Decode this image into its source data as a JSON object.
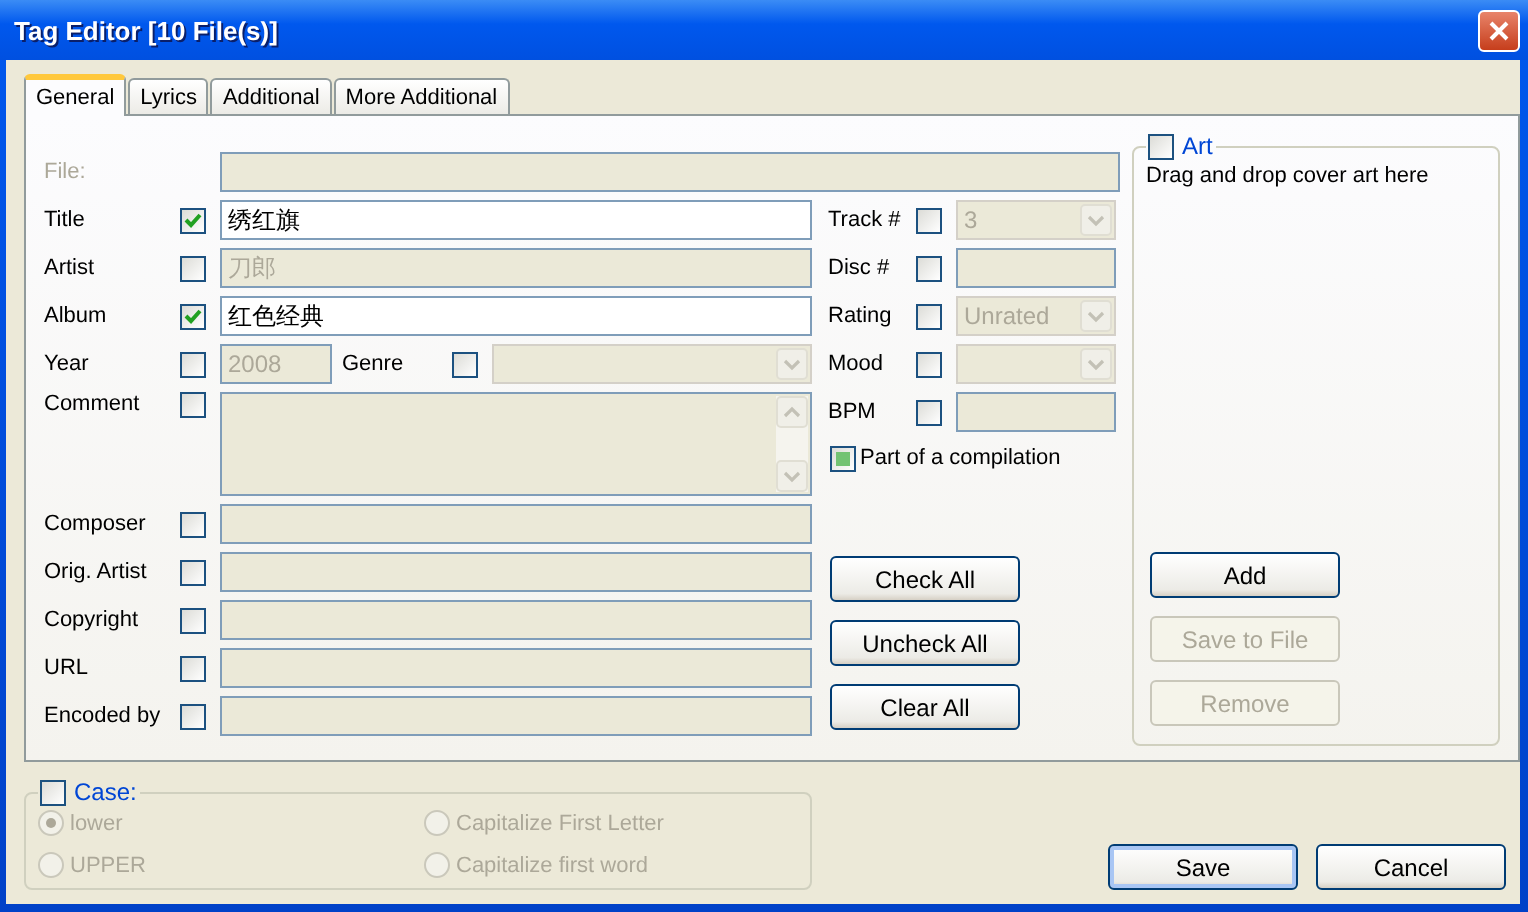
{
  "window": {
    "title": "Tag Editor [10 File(s)]"
  },
  "tabs": [
    {
      "label": "General",
      "selected": true
    },
    {
      "label": "Lyrics",
      "selected": false
    },
    {
      "label": "Additional",
      "selected": false
    },
    {
      "label": "More Additional",
      "selected": false
    }
  ],
  "file": {
    "label": "File:",
    "enabled": false
  },
  "fields": [
    {
      "kind": "text",
      "label": "Title",
      "checked": true,
      "value": "绣红旗"
    },
    {
      "kind": "text",
      "label": "Artist",
      "checked": false,
      "value": "刀郎"
    },
    {
      "kind": "text",
      "label": "Album",
      "checked": true,
      "value": "红色经典"
    },
    {
      "kind": "year",
      "label": "Year",
      "checked": false,
      "value": "2008",
      "genre": {
        "label": "Genre",
        "checked": false
      }
    },
    {
      "kind": "memo",
      "label": "Comment",
      "checked": false
    },
    {
      "kind": "text",
      "label": "Composer",
      "checked": false
    },
    {
      "kind": "text",
      "label": "Orig. Artist",
      "checked": false
    },
    {
      "kind": "text",
      "label": "Copyright",
      "checked": false
    },
    {
      "kind": "text",
      "label": "URL",
      "checked": false
    },
    {
      "kind": "text",
      "label": "Encoded by",
      "checked": false
    }
  ],
  "side_fields": [
    {
      "kind": "combo",
      "label": "Track #",
      "checked": false,
      "value": "3"
    },
    {
      "kind": "text",
      "label": "Disc #",
      "checked": false
    },
    {
      "kind": "combo",
      "label": "Rating",
      "checked": false,
      "value": "Unrated"
    },
    {
      "kind": "combo",
      "label": "Mood",
      "checked": false
    },
    {
      "kind": "text",
      "label": "BPM",
      "checked": false
    }
  ],
  "compilation": {
    "label": "Part of a compilation",
    "checked": false,
    "indeterminate": true
  },
  "check_buttons": [
    "Check All",
    "Uncheck All",
    "Clear All"
  ],
  "art": {
    "label": "Art",
    "checked": false,
    "hint": "Drag and drop cover art here",
    "buttons": [
      {
        "label": "Add",
        "disabled": false
      },
      {
        "label": "Save to File",
        "disabled": true
      },
      {
        "label": "Remove",
        "disabled": true
      }
    ]
  },
  "case": {
    "label": "Case:",
    "checked": false,
    "options": [
      {
        "label": "lower",
        "selected": true
      },
      {
        "label": "Capitalize First Letter",
        "selected": false
      },
      {
        "label": "UPPER",
        "selected": false
      },
      {
        "label": "Capitalize first word",
        "selected": false
      }
    ]
  },
  "dialog_buttons": [
    {
      "label": "Save",
      "default": true
    },
    {
      "label": "Cancel",
      "default": false
    }
  ]
}
